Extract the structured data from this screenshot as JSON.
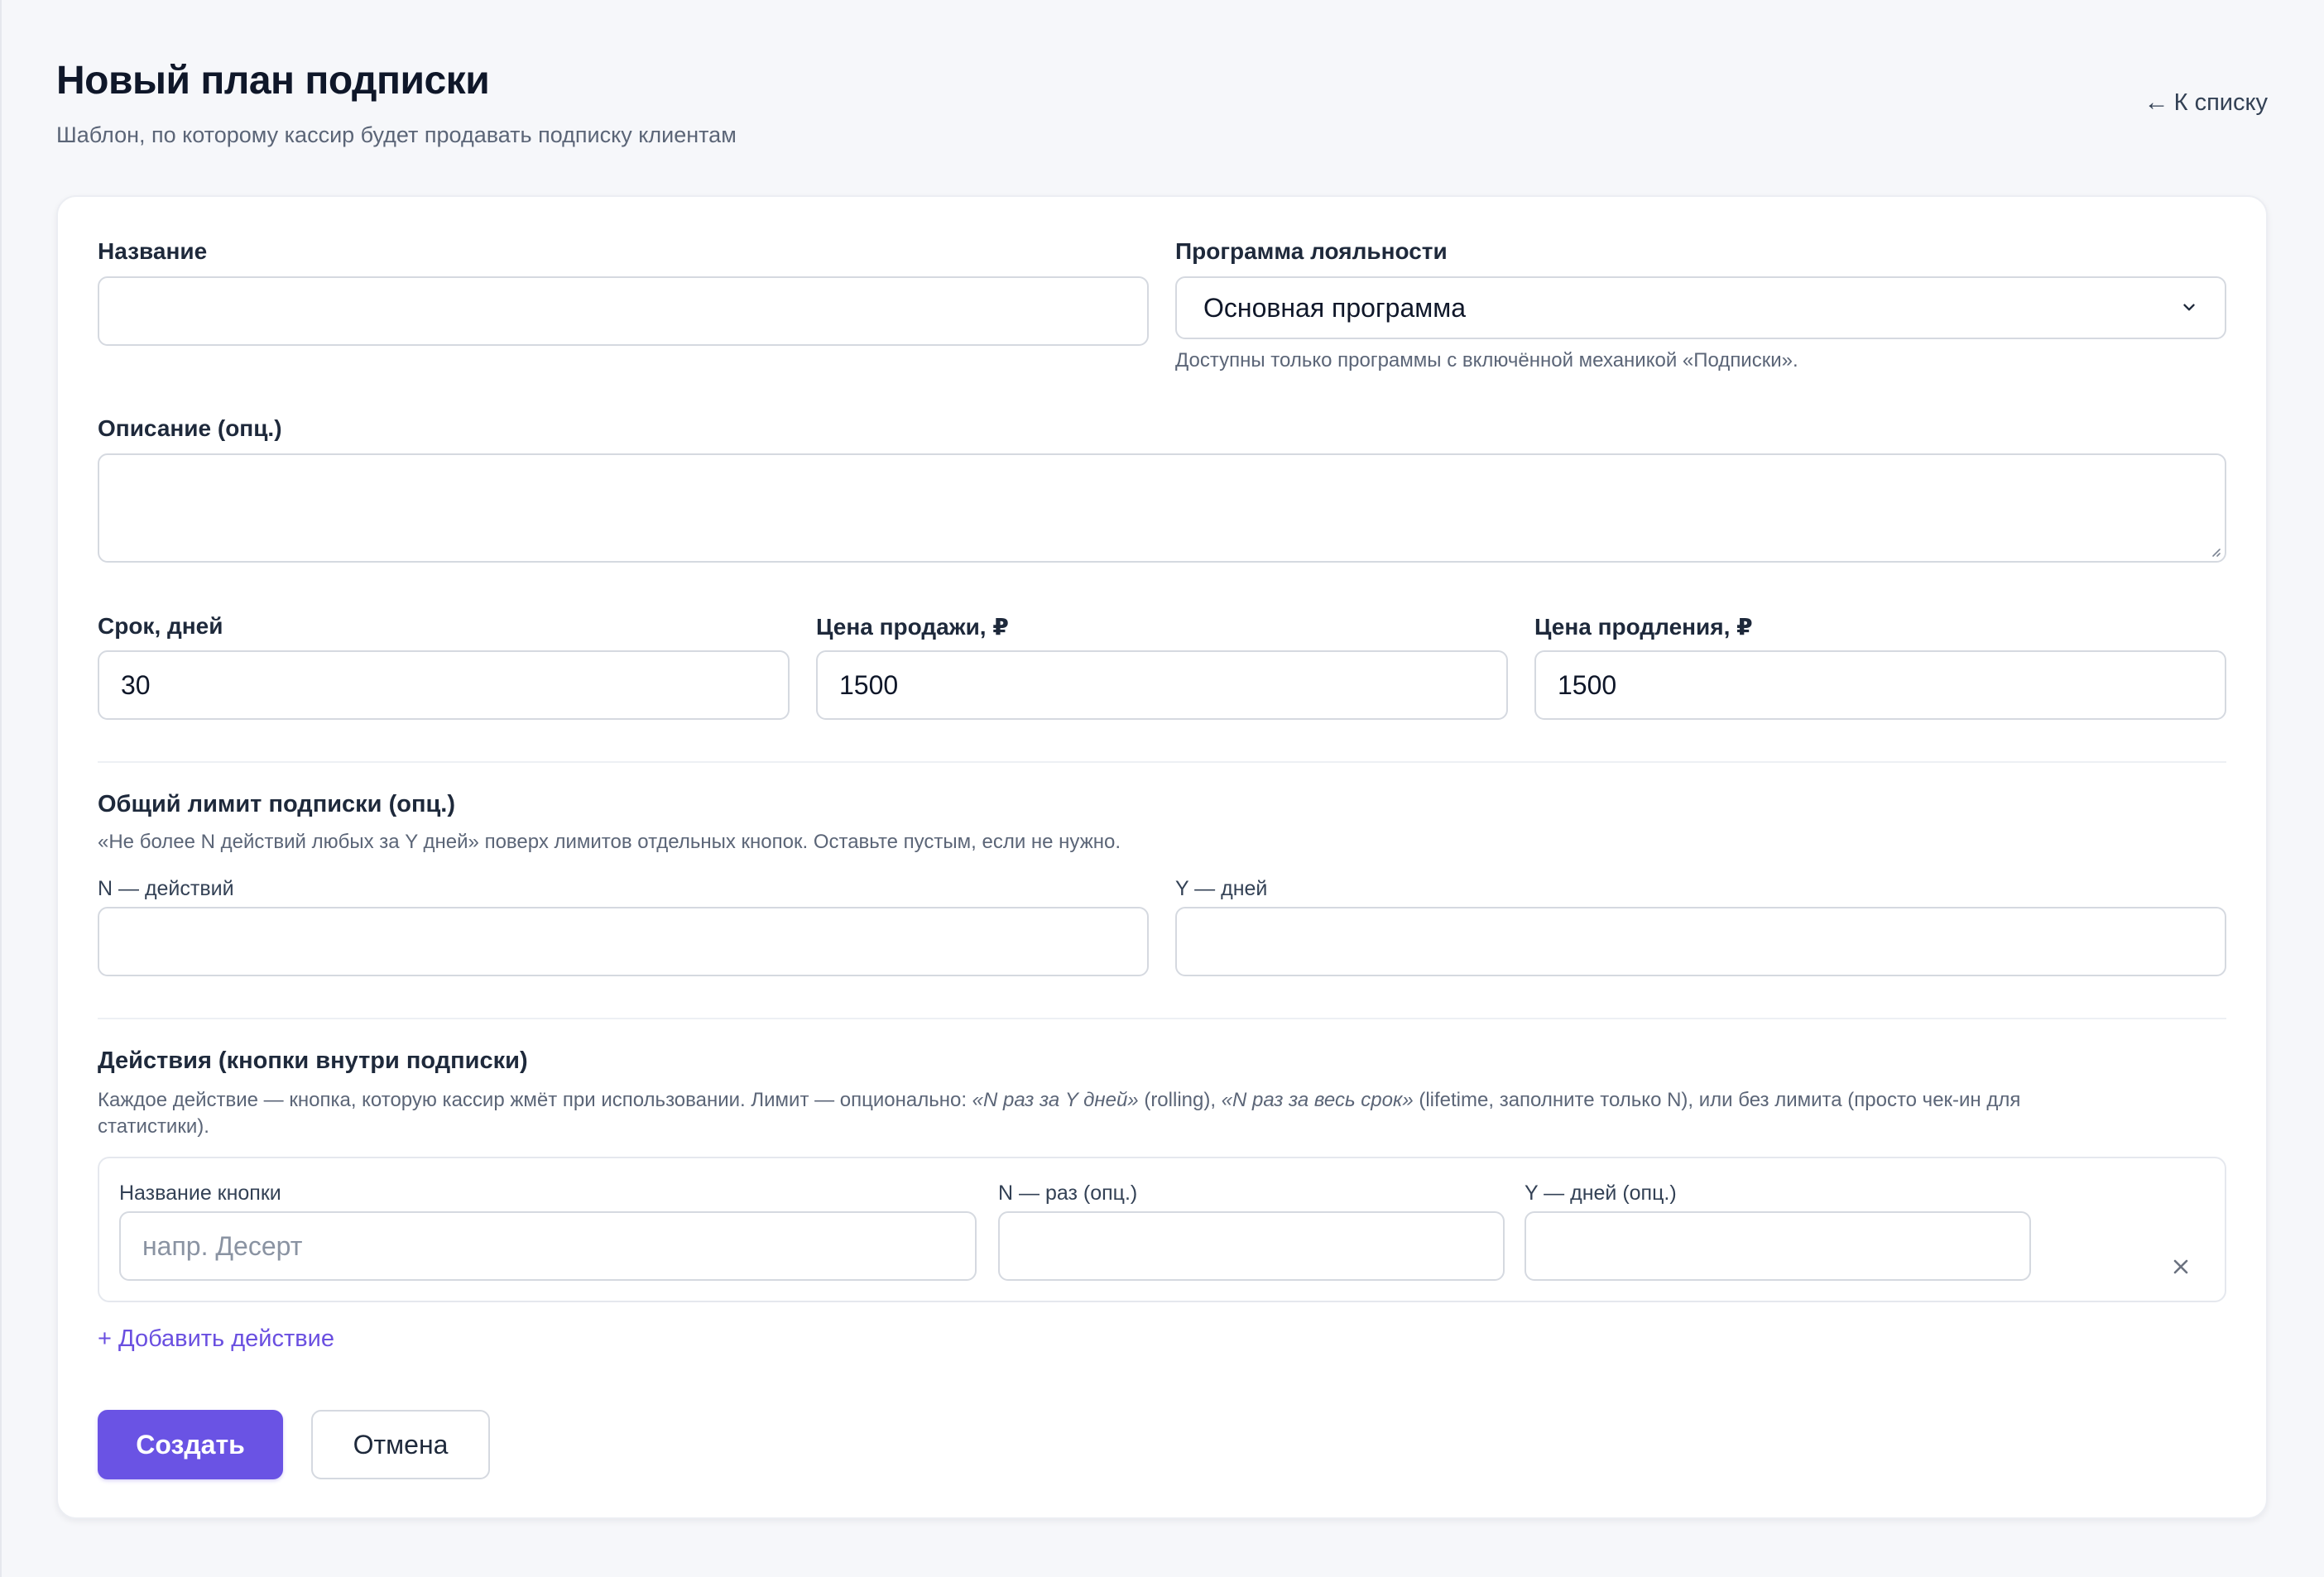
{
  "header": {
    "title": "Новый план подписки",
    "subtitle": "Шаблон, по которому кассир будет продавать подписку клиентам",
    "back_arrow": "←",
    "back_label": "К списку"
  },
  "form": {
    "name": {
      "label": "Название",
      "value": ""
    },
    "program": {
      "label": "Программа лояльности",
      "selected": "Основная программа",
      "hint": "Доступны только программы с включённой механикой «Подписки»."
    },
    "description": {
      "label": "Описание (опц.)",
      "value": ""
    },
    "duration": {
      "label": "Срок, дней",
      "value": "30"
    },
    "sale_price": {
      "label": "Цена продажи, ₽",
      "value": "1500"
    },
    "renew_price": {
      "label": "Цена продления, ₽",
      "value": "1500"
    },
    "overall_limit": {
      "title": "Общий лимит подписки (опц.)",
      "hint": "«Не более N действий любых за Y дней» поверх лимитов отдельных кнопок. Оставьте пустым, если не нужно.",
      "n_label": "N — действий",
      "n_value": "",
      "y_label": "Y — дней",
      "y_value": ""
    },
    "actions": {
      "title": "Действия (кнопки внутри подписки)",
      "hint_part1": "Каждое действие — кнопка, которую кассир жмёт при использовании. Лимит — опционально: ",
      "hint_em1": "«N раз за Y дней»",
      "hint_part2": " (rolling), ",
      "hint_em2": "«N раз за весь срок»",
      "hint_part3": " (lifetime, заполните только N), или без лимита (просто чек-ин для",
      "hint_line2": "статистики).",
      "items": [
        {
          "name_label": "Название кнопки",
          "name_placeholder": "напр. Десерт",
          "name_value": "",
          "n_label": "N — раз (опц.)",
          "n_value": "",
          "y_label": "Y — дней (опц.)",
          "y_value": ""
        }
      ],
      "add_label": "+ Добавить действие"
    }
  },
  "buttons": {
    "create": "Создать",
    "cancel": "Отмена"
  },
  "colors": {
    "accent": "#6a53e4",
    "link": "#6a4fe0",
    "background": "#f6f7fa"
  }
}
